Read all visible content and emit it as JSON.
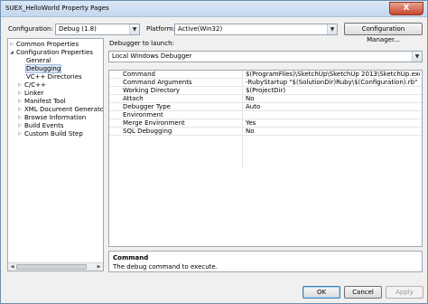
{
  "window": {
    "title": "SUEX_HelloWorld Property Pages",
    "close_label": "X"
  },
  "toolbar": {
    "configuration_label": "Configuration:",
    "configuration_value": "Debug (1.8)",
    "platform_label": "Platform:",
    "platform_value": "Active(Win32)",
    "configuration_manager_label": "Configuration Manager..."
  },
  "tree": {
    "items": [
      {
        "label": "Common Properties",
        "expander": "▷"
      },
      {
        "label": "Configuration Properties",
        "expander": "◢"
      },
      {
        "label": "General"
      },
      {
        "label": "Debugging"
      },
      {
        "label": "VC++ Directories"
      },
      {
        "label": "C/C++",
        "expander": "▷"
      },
      {
        "label": "Linker",
        "expander": "▷"
      },
      {
        "label": "Manifest Tool",
        "expander": "▷"
      },
      {
        "label": "XML Document Generator",
        "expander": "▷"
      },
      {
        "label": "Browse Information",
        "expander": "▷"
      },
      {
        "label": "Build Events",
        "expander": "▷"
      },
      {
        "label": "Custom Build Step",
        "expander": "▷"
      }
    ],
    "selected_index": 3
  },
  "debugger": {
    "launch_label": "Debugger to launch:",
    "launch_value": "Local Windows Debugger"
  },
  "properties": [
    {
      "name": "Command",
      "value": "$(ProgramFiles)\\SketchUp\\SketchUp 2013\\SketchUp.exe"
    },
    {
      "name": "Command Arguments",
      "value": "-RubyStartup \"$(SolutionDir)Ruby\\$(Configuration).rb\""
    },
    {
      "name": "Working Directory",
      "value": "$(ProjectDir)"
    },
    {
      "name": "Attach",
      "value": "No"
    },
    {
      "name": "Debugger Type",
      "value": "Auto"
    },
    {
      "name": "Environment",
      "value": ""
    },
    {
      "name": "Merge Environment",
      "value": "Yes"
    },
    {
      "name": "SQL Debugging",
      "value": "No"
    }
  ],
  "description": {
    "title": "Command",
    "text": "The debug command to execute."
  },
  "buttons": {
    "ok": "OK",
    "cancel": "Cancel",
    "apply": "Apply"
  },
  "colors": {
    "selection": "#dbe6f4",
    "close": "#c7472c"
  }
}
